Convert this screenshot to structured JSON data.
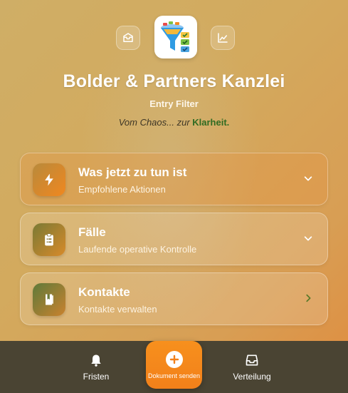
{
  "header": {
    "title": "Bolder & Partners Kanzlei",
    "subtitle": "Entry Filter",
    "tagline_prefix": "Vom Chaos... zur ",
    "tagline_strong": "Klarheit."
  },
  "cards": [
    {
      "title": "Was jetzt zu tun ist",
      "subtitle": "Empfohlene Aktionen",
      "icon": "lightning-icon",
      "chevron": "chevron-down-icon"
    },
    {
      "title": "Fälle",
      "subtitle": "Laufende operative Kontrolle",
      "icon": "clipboard-list-icon",
      "chevron": "chevron-down-icon"
    },
    {
      "title": "Kontakte",
      "subtitle": "Kontakte verwalten",
      "icon": "address-book-icon",
      "chevron": "chevron-right-icon"
    }
  ],
  "nav": {
    "fristen": "Fristen",
    "send": "Dokument senden",
    "verteilung": "Verteilung"
  },
  "colors": {
    "accent_orange": "#f2801a",
    "nav_background": "#4a4433",
    "highlight_green": "#2f6b22"
  }
}
